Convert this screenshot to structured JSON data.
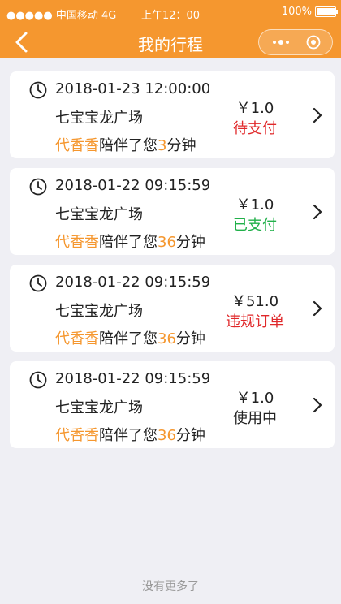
{
  "status_bar": {
    "carrier": "●●●●● 中国移动 4G",
    "time": "上午12：00",
    "battery_percent": "100%",
    "battery_level": 1.0
  },
  "nav": {
    "title": "我的行程",
    "back_icon": "chevron-left-icon",
    "more_icon": "more-dots-icon",
    "close_icon": "target-circle-icon"
  },
  "trips": [
    {
      "datetime": "2018-01-23 12:00:00",
      "place": "七宝宝龙广场",
      "companion": "代香香",
      "middle": "陪伴了您",
      "minutes": "3",
      "unit": "分钟",
      "price": "￥1.0",
      "status": "待支付",
      "status_color": "#e0282a"
    },
    {
      "datetime": "2018-01-22 09:15:59",
      "place": "七宝宝龙广场",
      "companion": "代香香",
      "middle": "陪伴了您",
      "minutes": "36",
      "unit": "分钟",
      "price": "￥1.0",
      "status": "已支付",
      "status_color": "#21b04a"
    },
    {
      "datetime": "2018-01-22 09:15:59",
      "place": "七宝宝龙广场",
      "companion": "代香香",
      "middle": "陪伴了您",
      "minutes": "36",
      "unit": "分钟",
      "price": "￥51.0",
      "status": "违规订单",
      "status_color": "#e0282a"
    },
    {
      "datetime": "2018-01-22 09:15:59",
      "place": "七宝宝龙广场",
      "companion": "代香香",
      "middle": "陪伴了您",
      "minutes": "36",
      "unit": "分钟",
      "price": "￥1.0",
      "status": "使用中",
      "status_color": "#222222"
    }
  ],
  "footer": {
    "text": "没有更多了"
  },
  "colors": {
    "accent": "#f5972f",
    "background": "#efeff4"
  }
}
